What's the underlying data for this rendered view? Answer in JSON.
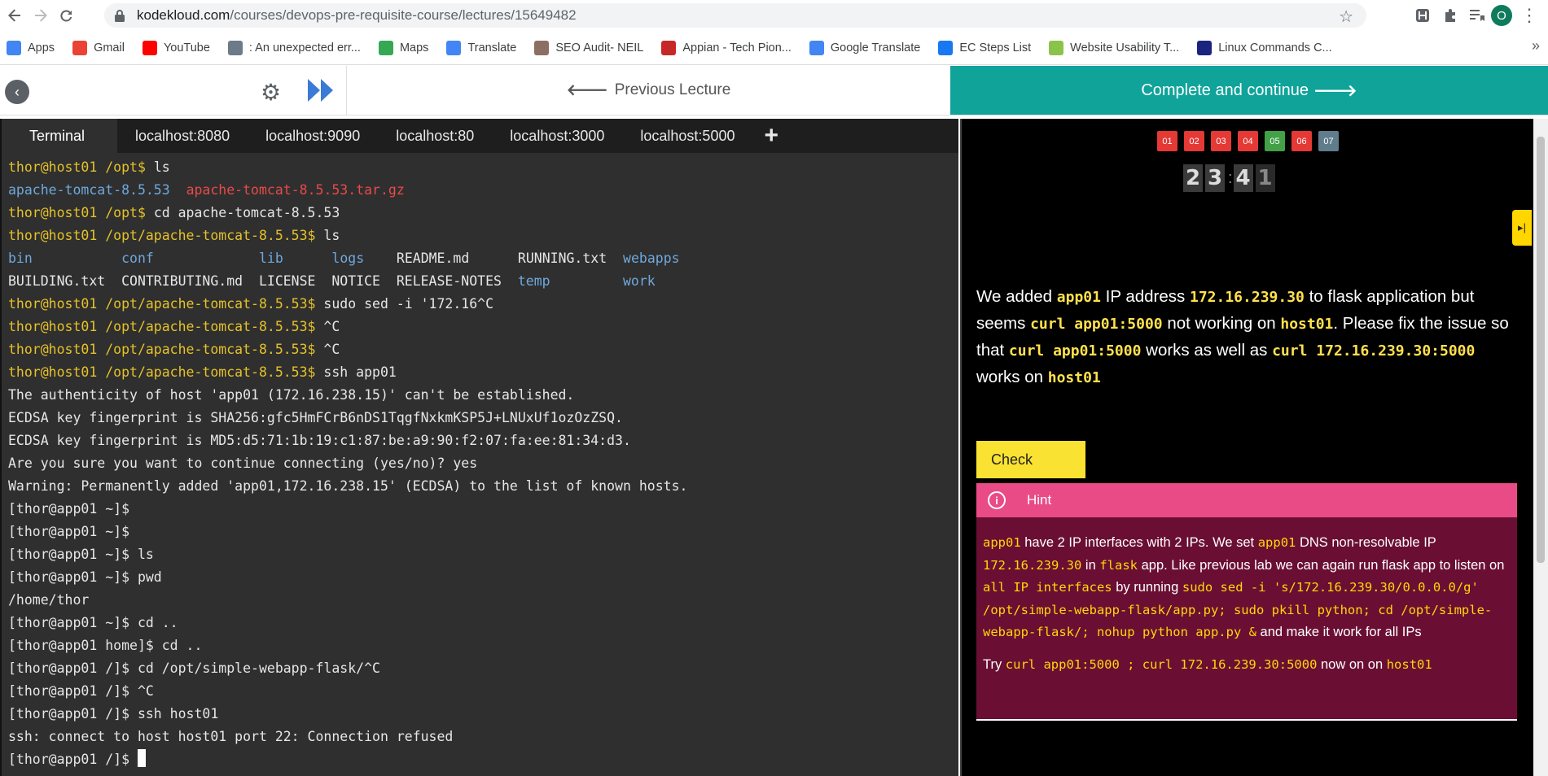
{
  "browser": {
    "url_host": "kodekloud.com",
    "url_path": "/courses/devops-pre-requisite-course/lectures/15649482",
    "avatar_letter": "O"
  },
  "bookmarks": [
    {
      "label": "Apps",
      "icon": "apps-grid-icon",
      "color": "#4285f4"
    },
    {
      "label": "Gmail",
      "icon": "gmail-icon",
      "color": "#ea4335"
    },
    {
      "label": "YouTube",
      "icon": "youtube-icon",
      "color": "#ff0000"
    },
    {
      "label": ": An unexpected err...",
      "icon": "jira-icon",
      "color": "#6c7a89"
    },
    {
      "label": "Maps",
      "icon": "maps-pin-icon",
      "color": "#34a853"
    },
    {
      "label": "Translate",
      "icon": "translate-icon",
      "color": "#4285f4"
    },
    {
      "label": "SEO Audit- NEIL",
      "icon": "neil-avatar-icon",
      "color": "#8d6e63"
    },
    {
      "label": "Appian - Tech Pion...",
      "icon": "appian-icon",
      "color": "#c62828"
    },
    {
      "label": "Google Translate",
      "icon": "google-translate-icon",
      "color": "#4285f4"
    },
    {
      "label": "EC Steps List",
      "icon": "facebook-icon",
      "color": "#1877f2"
    },
    {
      "label": "Website Usability T...",
      "icon": "ui-icon",
      "color": "#8bc34a"
    },
    {
      "label": "Linux Commands C...",
      "icon": "linux-icon",
      "color": "#1a237e"
    }
  ],
  "course_bar": {
    "prev_label": "Previous Lecture",
    "complete_label": "Complete and continue"
  },
  "terminal": {
    "tabs": [
      "Terminal",
      "localhost:8080",
      "localhost:9090",
      "localhost:80",
      "localhost:3000",
      "localhost:5000",
      "+"
    ],
    "lines": [
      [
        {
          "t": "thor@host01 /opt$ ",
          "c": "p-user"
        },
        {
          "t": "ls"
        }
      ],
      [
        {
          "t": "apache-tomcat-8.5.53",
          "c": "c-blue"
        },
        {
          "t": "  "
        },
        {
          "t": "apache-tomcat-8.5.53.tar.gz",
          "c": "c-red"
        }
      ],
      [
        {
          "t": "thor@host01 /opt$ ",
          "c": "p-user"
        },
        {
          "t": "cd apache-tomcat-8.5.53"
        }
      ],
      [
        {
          "t": "thor@host01 /opt/apache-tomcat-8.5.53$ ",
          "c": "p-user"
        },
        {
          "t": "ls"
        }
      ],
      [
        {
          "t": "bin",
          "c": "c-blue"
        },
        {
          "t": "           "
        },
        {
          "t": "conf",
          "c": "c-blue"
        },
        {
          "t": "             "
        },
        {
          "t": "lib",
          "c": "c-blue"
        },
        {
          "t": "      "
        },
        {
          "t": "logs",
          "c": "c-blue"
        },
        {
          "t": "    README.md      RUNNING.txt  "
        },
        {
          "t": "webapps",
          "c": "c-blue"
        }
      ],
      [
        {
          "t": "BUILDING.txt  CONTRIBUTING.md  LICENSE  NOTICE  RELEASE-NOTES  "
        },
        {
          "t": "temp",
          "c": "c-blue"
        },
        {
          "t": "         "
        },
        {
          "t": "work",
          "c": "c-blue"
        }
      ],
      [
        {
          "t": "thor@host01 /opt/apache-tomcat-8.5.53$ ",
          "c": "p-user"
        },
        {
          "t": "sudo sed -i '172.16^C"
        }
      ],
      [
        {
          "t": "thor@host01 /opt/apache-tomcat-8.5.53$ ",
          "c": "p-user"
        },
        {
          "t": "^C"
        }
      ],
      [
        {
          "t": "thor@host01 /opt/apache-tomcat-8.5.53$ ",
          "c": "p-user"
        },
        {
          "t": "^C"
        }
      ],
      [
        {
          "t": "thor@host01 /opt/apache-tomcat-8.5.53$ ",
          "c": "p-user"
        },
        {
          "t": "ssh app01"
        }
      ],
      [
        {
          "t": "The authenticity of host 'app01 (172.16.238.15)' can't be established."
        }
      ],
      [
        {
          "t": "ECDSA key fingerprint is SHA256:gfc5HmFCrB6nDS1TqgfNxkmKSP5J+LNUxUf1ozOzZSQ."
        }
      ],
      [
        {
          "t": "ECDSA key fingerprint is MD5:d5:71:1b:19:c1:87:be:a9:90:f2:07:fa:ee:81:34:d3."
        }
      ],
      [
        {
          "t": "Are you sure you want to continue connecting (yes/no)? yes"
        }
      ],
      [
        {
          "t": "Warning: Permanently added 'app01,172.16.238.15' (ECDSA) to the list of known hosts."
        }
      ],
      [
        {
          "t": "[thor@app01 ~]$ "
        }
      ],
      [
        {
          "t": "[thor@app01 ~]$ "
        }
      ],
      [
        {
          "t": "[thor@app01 ~]$ ls"
        }
      ],
      [
        {
          "t": "[thor@app01 ~]$ pwd"
        }
      ],
      [
        {
          "t": "/home/thor"
        }
      ],
      [
        {
          "t": "[thor@app01 ~]$ cd .."
        }
      ],
      [
        {
          "t": "[thor@app01 home]$ cd .."
        }
      ],
      [
        {
          "t": "[thor@app01 /]$ cd /opt/simple-webapp-flask/^C"
        }
      ],
      [
        {
          "t": "[thor@app01 /]$ ^C"
        }
      ],
      [
        {
          "t": "[thor@app01 /]$ ssh host01"
        }
      ],
      [
        {
          "t": "ssh: connect to host host01 port 22: Connection refused"
        }
      ],
      [
        {
          "t": "[thor@app01 /]$ "
        },
        {
          "t": "",
          "c": "cursor"
        }
      ]
    ]
  },
  "task_panel": {
    "questions": [
      {
        "label": "01",
        "color": "#e53935"
      },
      {
        "label": "02",
        "color": "#e53935"
      },
      {
        "label": "03",
        "color": "#e53935"
      },
      {
        "label": "04",
        "color": "#e53935"
      },
      {
        "label": "05",
        "color": "#43a047"
      },
      {
        "label": "06",
        "color": "#e53935"
      },
      {
        "label": "07",
        "color": "#607d8b"
      }
    ],
    "timer_digits": [
      "2",
      "3",
      "4",
      "1"
    ],
    "task_parts": [
      {
        "t": "We added "
      },
      {
        "t": "app01",
        "hl": true
      },
      {
        "t": " IP address "
      },
      {
        "t": "172.16.239.30",
        "hl": true
      },
      {
        "t": " to flask application but seems "
      },
      {
        "t": "curl app01:5000",
        "hl": true
      },
      {
        "t": " not working on "
      },
      {
        "t": "host01",
        "hl": true
      },
      {
        "t": ". Please fix the issue so that "
      },
      {
        "t": "curl app01:5000",
        "hl": true
      },
      {
        "t": " works as well as "
      },
      {
        "t": "curl 172.16.239.30:5000",
        "hl": true
      },
      {
        "t": " works on "
      },
      {
        "t": "host01",
        "hl": true
      }
    ],
    "check_label": "Check",
    "hint_label": "Hint",
    "hint_p1": [
      {
        "t": "app01",
        "hl": true
      },
      {
        "t": " have 2 IP interfaces with 2 IPs. We set "
      },
      {
        "t": "app01",
        "hl": true
      },
      {
        "t": " DNS non-resolvable IP "
      },
      {
        "t": "172.16.239.30",
        "hl": true
      },
      {
        "t": " in "
      },
      {
        "t": "flask",
        "hl": true
      },
      {
        "t": " app. Like previous lab we can again run flask app to listen on "
      },
      {
        "t": "all IP interfaces",
        "hl": true
      },
      {
        "t": " by running "
      },
      {
        "t": "sudo sed -i 's/172.16.239.30/0.0.0.0/g' /opt/simple-webapp-flask/app.py; sudo pkill python; cd /opt/simple-webapp-flask/; nohup python app.py &",
        "hl": true
      },
      {
        "t": " and make it work for all IPs"
      }
    ],
    "hint_p2": [
      {
        "t": "Try "
      },
      {
        "t": "curl app01:5000 ; curl 172.16.239.30:5000",
        "hl": true
      },
      {
        "t": " now on on "
      },
      {
        "t": "host01",
        "hl": true
      }
    ]
  }
}
